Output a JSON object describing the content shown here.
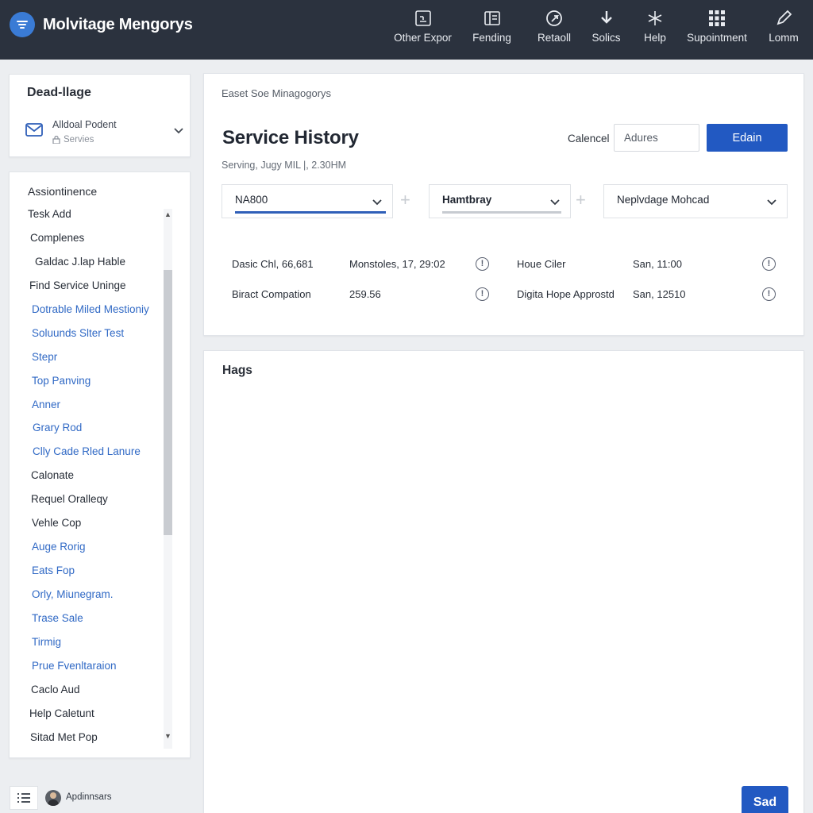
{
  "app": {
    "title": "Molvitage Mengorys",
    "accent_color": "#2259c2",
    "topbar_color": "#2b323e"
  },
  "nav": [
    {
      "label": "Other Expor",
      "icon": "export-icon"
    },
    {
      "label": "Fending",
      "icon": "panel-icon"
    },
    {
      "label": "Retaoll",
      "icon": "play-circle-icon"
    },
    {
      "label": "Solics",
      "icon": "download-icon"
    },
    {
      "label": "Help",
      "icon": "sparkle-icon"
    },
    {
      "label": "Supointment",
      "icon": "grid-icon"
    },
    {
      "label": "Lomm",
      "icon": "pencil-icon"
    }
  ],
  "account": {
    "title": "Dead-llage",
    "name": "Alldoal Podent",
    "subtitle": "Servies"
  },
  "menu": {
    "header": "Assiontinence",
    "items": [
      {
        "label": "Tesk Add",
        "style": "dark"
      },
      {
        "label": "Complenes",
        "style": "dark"
      },
      {
        "label": "Galdac J.lap Hable",
        "style": "dark"
      },
      {
        "label": "Find Service Uninge",
        "style": "dark"
      },
      {
        "label": "Dotrable Miled Mestioniy",
        "style": "blue"
      },
      {
        "label": "Soluunds Slter Test",
        "style": "blue"
      },
      {
        "label": "Stepr",
        "style": "blue"
      },
      {
        "label": "Top Panving",
        "style": "blue"
      },
      {
        "label": "Anner",
        "style": "blue"
      },
      {
        "label": "Grary Rod",
        "style": "blue"
      },
      {
        "label": "Clly Cade Rled Lanure",
        "style": "blue"
      },
      {
        "label": "Calonate",
        "style": "dark"
      },
      {
        "label": "Requel Oralleqy",
        "style": "dark"
      },
      {
        "label": "Vehle Cop",
        "style": "dark"
      },
      {
        "label": "Auge Rorig",
        "style": "blue"
      },
      {
        "label": "Eats Fop",
        "style": "blue"
      },
      {
        "label": "Orly, Miunegram.",
        "style": "blue"
      },
      {
        "label": "Trase Sale",
        "style": "blue"
      },
      {
        "label": "Tirmig",
        "style": "blue"
      },
      {
        "label": "Prue Fvenltaraion",
        "style": "blue"
      },
      {
        "label": "Caclo Aud",
        "style": "dark"
      },
      {
        "label": "Help Caletunt",
        "style": "dark"
      },
      {
        "label": "Sitad Met Pop",
        "style": "dark"
      }
    ],
    "scroll_position": 0.12
  },
  "user": {
    "name": "Apdinnsars"
  },
  "main": {
    "breadcrumb": "Easet Soe Minagogorys",
    "title": "Service History",
    "subtitle": "Serving, Jugy MIL |, 2.30HM",
    "cancel_label": "Calencel",
    "search_placeholder": "Adures",
    "primary_label": "Edain",
    "filters": [
      {
        "value": "NA800",
        "underline_color": "#2f5fb8"
      },
      {
        "value": "Hamtbray",
        "underline_color": "#c7cbd1"
      },
      {
        "value": "Neplvdage Mohcad",
        "underline_color": ""
      }
    ],
    "history": [
      {
        "c1": "Dasic Chl, 66,681",
        "c2": "Monstoles, 17, 29:02",
        "c3": "Houe Ciler",
        "c4": "San, 11:00"
      },
      {
        "c1": "Biract Compation",
        "c2": "259.56",
        "c3": "Digita Hope Approstd",
        "c4": "San, 12510"
      }
    ]
  },
  "tags": {
    "title": "Hags"
  },
  "save_label": "Sad"
}
